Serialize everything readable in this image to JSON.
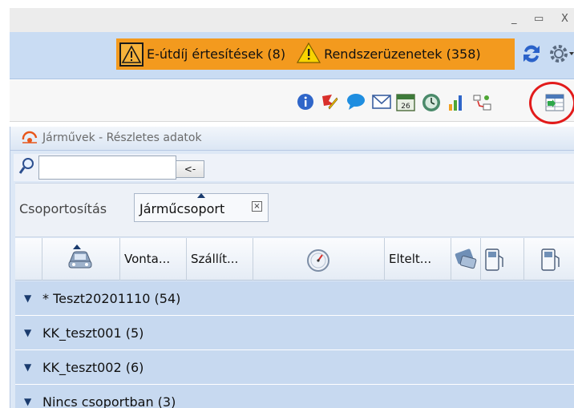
{
  "window": {
    "minimize": "_",
    "maximize": "▭",
    "close": "X"
  },
  "notifications": {
    "toll_label": "E-útdíj értesítések (8)",
    "system_label": "Rendszerüzenetek (358)"
  },
  "toolbar": {
    "icons": [
      "info-icon",
      "flag-pen-icon",
      "chat-bubble-icon",
      "mail-icon",
      "calendar-icon",
      "clock-icon",
      "bar-chart-icon",
      "route-icon",
      "export-grid-icon"
    ],
    "calendar_day": "26",
    "highlight_color": "#e21b1b"
  },
  "panel": {
    "title": "Járművek - Részletes adatok",
    "search": {
      "value": "",
      "button_label": "<-"
    },
    "grouping": {
      "label": "Csoportosítás",
      "chip_label": "Járműcsoport",
      "chip_close": "×"
    },
    "columns": [
      "Vonta...",
      "Szállít...",
      "Eltelt..."
    ],
    "groups": [
      {
        "label": "* Teszt20201110 (54)"
      },
      {
        "label": "KK_teszt001 (5)"
      },
      {
        "label": "KK_teszt002 (6)"
      },
      {
        "label": "Nincs csoportban (3)"
      }
    ]
  },
  "colors": {
    "accent_orange": "#f39a1e",
    "header_blue": "#c9dcf3",
    "row_blue": "#c7d9f0"
  }
}
